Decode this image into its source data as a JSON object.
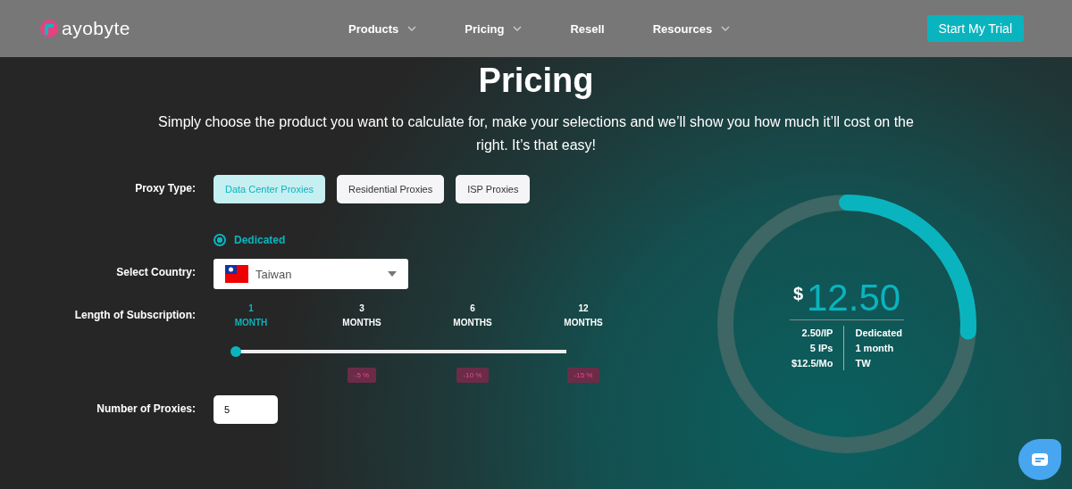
{
  "header": {
    "logo_text": "ayobyte",
    "nav": [
      {
        "label": "Products",
        "dropdown": true
      },
      {
        "label": "Pricing",
        "dropdown": true
      },
      {
        "label": "Resell",
        "dropdown": false
      },
      {
        "label": "Resources",
        "dropdown": true
      }
    ],
    "cta": "Start My Trial"
  },
  "title": "Pricing",
  "intro": "Simply choose the product you want to calculate for, make your selections and we’ll show you how much it’ll cost on the right. It’s that easy!",
  "proxy_type": {
    "label": "Proxy Type:",
    "options": [
      {
        "label": "Data Center Proxies",
        "selected": true
      },
      {
        "label": "Residential Proxies",
        "selected": false
      },
      {
        "label": "ISP Proxies",
        "selected": false
      }
    ],
    "plan": {
      "label": "Dedicated",
      "selected": true
    }
  },
  "country": {
    "label": "Select Country:",
    "value": "Taiwan"
  },
  "subscription": {
    "label": "Length of Subscription:",
    "level": 0,
    "options": [
      {
        "count": "1",
        "unit": "MONTH",
        "selected": true
      },
      {
        "count": "3",
        "unit": "MONTHS",
        "selected": false,
        "discount": "-5 %"
      },
      {
        "count": "6",
        "unit": "MONTHS",
        "selected": false,
        "discount": "-10 %"
      },
      {
        "count": "12",
        "unit": "MONTHS",
        "selected": false,
        "discount": "-15 %"
      }
    ]
  },
  "proxies": {
    "label": "Number of Proxies:",
    "value": "5"
  },
  "summary": {
    "level": 0.26,
    "currency": "$",
    "price": "12.50",
    "left": [
      "2.50/IP",
      "5 IPs",
      "$12.5/Mo"
    ],
    "right": [
      "Dedicated",
      "1 month",
      "TW"
    ]
  }
}
